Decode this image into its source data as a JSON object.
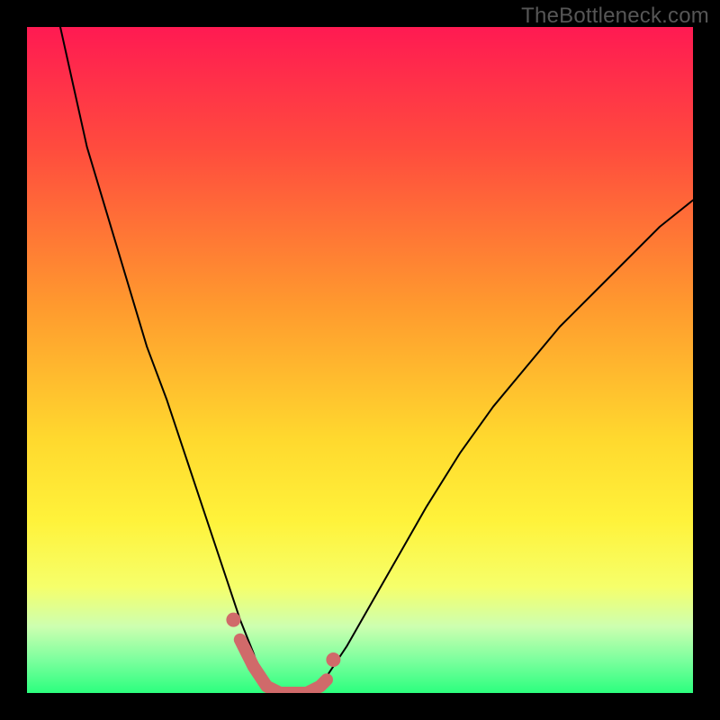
{
  "watermark": "TheBottleneck.com",
  "chart_data": {
    "type": "line",
    "title": "",
    "xlabel": "",
    "ylabel": "",
    "xlim": [
      0,
      100
    ],
    "ylim": [
      0,
      100
    ],
    "background_gradient_stops": [
      {
        "pct": 0,
        "color": "#ff1a52"
      },
      {
        "pct": 18,
        "color": "#ff4b3e"
      },
      {
        "pct": 42,
        "color": "#ff9a2e"
      },
      {
        "pct": 62,
        "color": "#ffd92e"
      },
      {
        "pct": 74,
        "color": "#fff23a"
      },
      {
        "pct": 84,
        "color": "#f6ff6a"
      },
      {
        "pct": 90,
        "color": "#cdffb0"
      },
      {
        "pct": 95,
        "color": "#7dff9e"
      },
      {
        "pct": 100,
        "color": "#2cff7e"
      }
    ],
    "series": [
      {
        "name": "bottleneck-curve",
        "stroke": "#000000",
        "stroke_width": 2,
        "x": [
          5,
          7,
          9,
          12,
          15,
          18,
          21,
          24,
          26,
          28,
          30,
          32,
          34,
          35,
          36,
          38,
          40,
          42,
          44,
          48,
          52,
          56,
          60,
          65,
          70,
          75,
          80,
          85,
          90,
          95,
          100
        ],
        "y": [
          100,
          91,
          82,
          72,
          62,
          52,
          44,
          35,
          29,
          23,
          17,
          11,
          6,
          3,
          1,
          0,
          0,
          0,
          1,
          7,
          14,
          21,
          28,
          36,
          43,
          49,
          55,
          60,
          65,
          70,
          74
        ]
      },
      {
        "name": "marker-band",
        "stroke": "#d06a6a",
        "stroke_width": 14,
        "x": [
          32,
          34,
          36,
          38,
          40,
          42,
          44,
          45
        ],
        "y": [
          8,
          4,
          1,
          0,
          0,
          0,
          1,
          2
        ]
      }
    ],
    "marker_dots": {
      "color": "#d06a6a",
      "radius": 8,
      "points": [
        {
          "x": 31,
          "y": 11
        },
        {
          "x": 46,
          "y": 5
        }
      ]
    }
  }
}
